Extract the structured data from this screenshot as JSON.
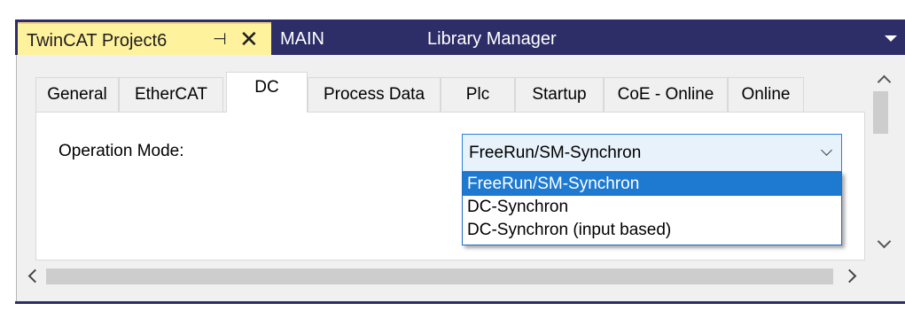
{
  "document_tabs": {
    "active": {
      "title": "TwinCAT Project6",
      "pin_glyph": "⊣",
      "close_glyph": "✕"
    },
    "others": [
      "MAIN",
      "Library Manager"
    ]
  },
  "property_tabs": [
    {
      "label": "General",
      "active": false
    },
    {
      "label": "EtherCAT",
      "active": false
    },
    {
      "label": "DC",
      "active": true
    },
    {
      "label": "Process Data",
      "active": false
    },
    {
      "label": "Plc",
      "active": false
    },
    {
      "label": "Startup",
      "active": false
    },
    {
      "label": "CoE - Online",
      "active": false
    },
    {
      "label": "Online",
      "active": false
    }
  ],
  "dc_page": {
    "operation_mode_label": "Operation Mode:",
    "operation_mode_value": "FreeRun/SM-Synchron",
    "options": [
      "FreeRun/SM-Synchron",
      "DC-Synchron",
      "DC-Synchron (input based)"
    ],
    "selected_option": "FreeRun/SM-Synchron"
  },
  "colors": {
    "frame": "#2d2d68",
    "active_doc_tab": "#fff29d",
    "selection": "#1e7ad0",
    "combo_border": "#2a82da"
  },
  "icons": {
    "pin": "pin-icon",
    "close": "close-icon",
    "overflow": "dropdown-arrow-icon"
  }
}
